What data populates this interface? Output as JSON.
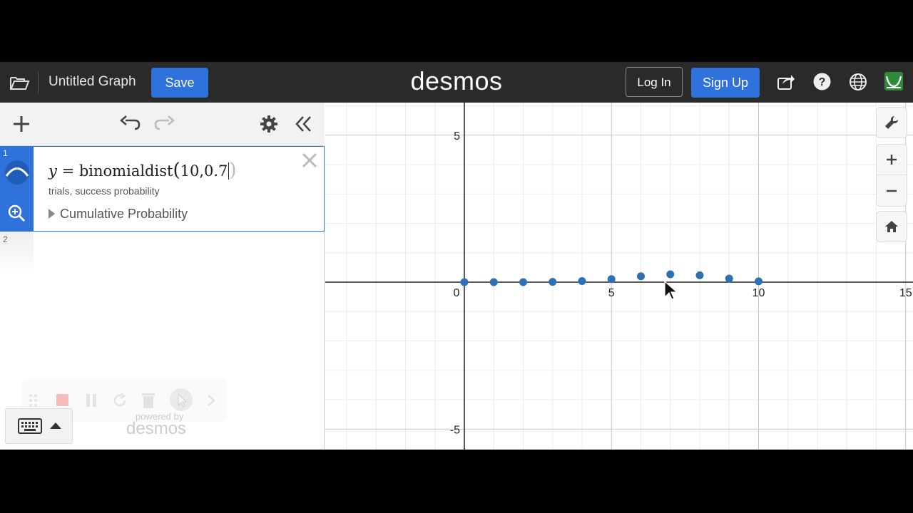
{
  "header": {
    "title": "Untitled Graph",
    "save_label": "Save",
    "logo": "desmos",
    "login_label": "Log In",
    "signup_label": "Sign Up"
  },
  "expression_list": {
    "items": [
      {
        "index": "1",
        "lhs": "y",
        "equals": "=",
        "func": "binomialdist",
        "args": "10,0.7",
        "param_hint": "trials,  success probability",
        "dropdown_label": "Cumulative Probability"
      },
      {
        "index": "2"
      }
    ]
  },
  "powered_by": {
    "label": "powered by",
    "logo": "desmos"
  },
  "graph": {
    "x_ticks": [
      "0",
      "5",
      "10",
      "15"
    ],
    "y_ticks": [
      "5",
      "-5"
    ],
    "accent_color": "#2d70b3"
  },
  "chart_data": {
    "type": "scatter",
    "x": [
      0,
      1,
      2,
      3,
      4,
      5,
      6,
      7,
      8,
      9,
      10
    ],
    "y": [
      5.9e-06,
      0.000138,
      0.00145,
      0.009,
      0.0368,
      0.1029,
      0.2001,
      0.2668,
      0.2335,
      0.1211,
      0.0282
    ],
    "xlim": [
      -4.7,
      15
    ],
    "ylim": [
      -5.4,
      6.3
    ],
    "grid": true,
    "color": "#2d70b3"
  }
}
